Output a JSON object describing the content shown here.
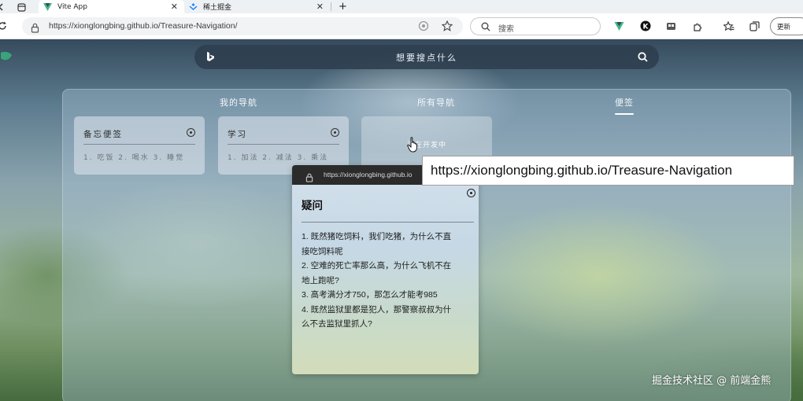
{
  "browser": {
    "tabs": [
      {
        "title": "Vite App",
        "active": true,
        "icon": "vue-icon"
      },
      {
        "title": "稀土掘金",
        "active": false,
        "icon": "juejin-icon"
      }
    ],
    "new_tab_label": "+",
    "url": "https://xionglongbing.github.io/Treasure-Navigation/",
    "search_placeholder": "搜索",
    "update_button": "更新"
  },
  "page": {
    "search_placeholder": "想要搜点什么",
    "nav_tabs": [
      {
        "label": "我的导航"
      },
      {
        "label": "所有导航"
      },
      {
        "label": "便签",
        "active": true
      }
    ],
    "memos": [
      {
        "title": "备忘便签",
        "body": "1. 吃饭 2. 喝水 3. 睡觉"
      },
      {
        "title": "学习",
        "body": "1. 加法 2. 减法 3. 乘法"
      }
    ],
    "dev_card_text": "正在开发中"
  },
  "popup": {
    "url": "https://xionglongbing.github.io",
    "title": "疑问",
    "lines": [
      "1. 既然猪吃饲料，我们吃猪，为什么不直",
      "接吃饲料呢",
      "2. 空难的死亡率那么高，为什么飞机不在",
      "地上跑呢?",
      "3. 高考满分才750，那怎么才能考985",
      "4. 既然监狱里都是犯人，那警察叔叔为什",
      "么不去监狱里抓人?"
    ]
  },
  "tooltip": "https://xionglongbing.github.io/Treasure-Navigation",
  "watermark": "掘金技术社区 @ 前端金熊",
  "colors": {
    "search_bar": "#2d3e4e",
    "popup_bar": "#2b2b2b",
    "vue_green": "#41b883",
    "juejin_blue": "#1e80ff"
  }
}
